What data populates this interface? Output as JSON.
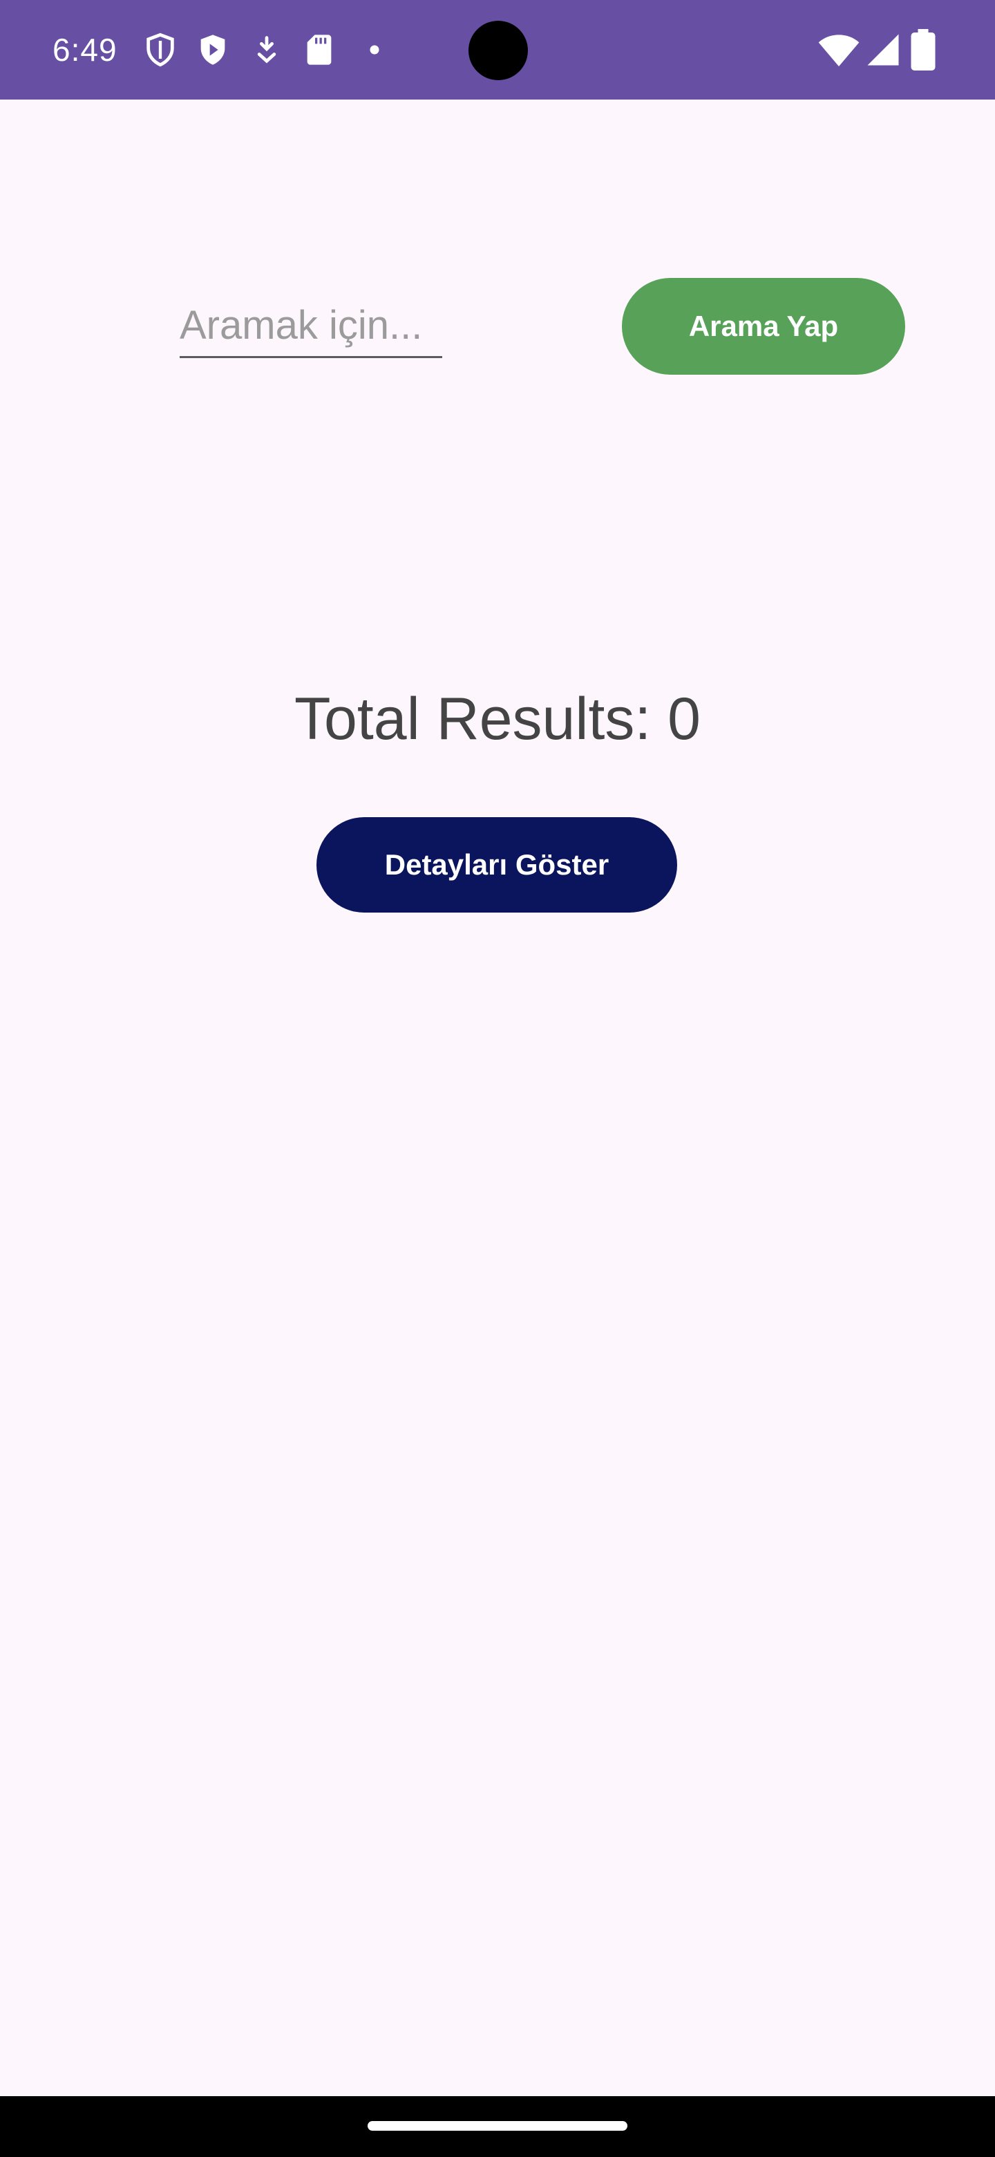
{
  "status_bar": {
    "time": "6:49",
    "background_color": "#6750a4",
    "icons_left": [
      "shield-outline-icon",
      "play-protect-icon",
      "download-icon",
      "sd-card-icon",
      "notification-dot-icon"
    ],
    "icons_right": [
      "wifi-icon",
      "signal-icon",
      "battery-icon"
    ]
  },
  "search": {
    "placeholder": "Aramak için...",
    "value": "",
    "button_label": "Arama Yap",
    "button_color": "#58a159"
  },
  "results": {
    "label": "Total Results: 0"
  },
  "details": {
    "button_label": "Detayları Göster",
    "button_color": "#0b155e"
  },
  "theme": {
    "background": "#fdf7fd"
  }
}
